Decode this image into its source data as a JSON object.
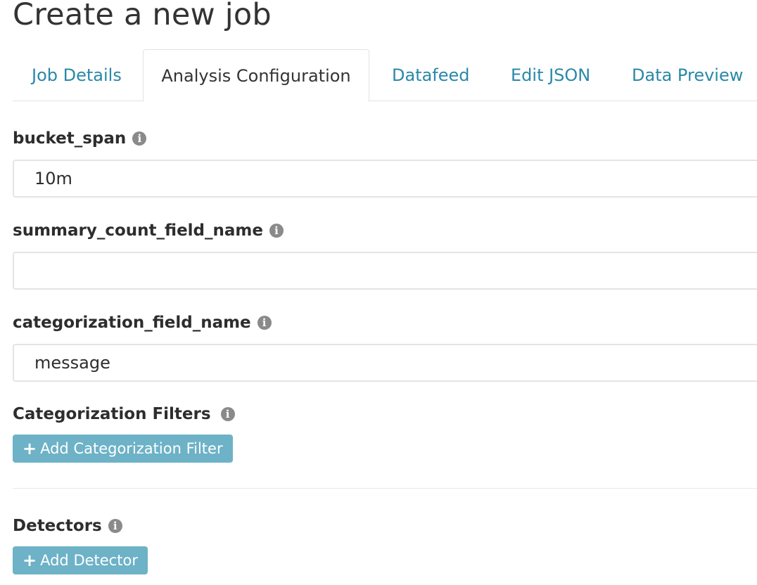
{
  "page": {
    "title": "Create a new job"
  },
  "tabs": [
    {
      "label": "Job Details",
      "active": false
    },
    {
      "label": "Analysis Configuration",
      "active": true
    },
    {
      "label": "Datafeed",
      "active": false
    },
    {
      "label": "Edit JSON",
      "active": false
    },
    {
      "label": "Data Preview",
      "active": false
    }
  ],
  "form": {
    "bucket_span": {
      "label": "bucket_span",
      "value": "10m",
      "info_icon": "info-icon"
    },
    "summary_count_field_name": {
      "label": "summary_count_field_name",
      "value": "",
      "info_icon": "info-icon"
    },
    "categorization_field_name": {
      "label": "categorization_field_name",
      "value": "message",
      "info_icon": "info-icon"
    },
    "categorization_filters": {
      "label": "Categorization Filters",
      "button_label": "Add Categorization Filter",
      "button_icon": "plus-icon",
      "info_icon": "info-icon"
    },
    "detectors": {
      "label": "Detectors",
      "button_label": "Add Detector",
      "button_icon": "plus-icon",
      "info_icon": "info-icon"
    }
  },
  "colors": {
    "tab_link": "#2a88a8",
    "button_bg": "#6db2c7",
    "info_icon": "#8a8a8a",
    "text": "#2d2d2d"
  }
}
